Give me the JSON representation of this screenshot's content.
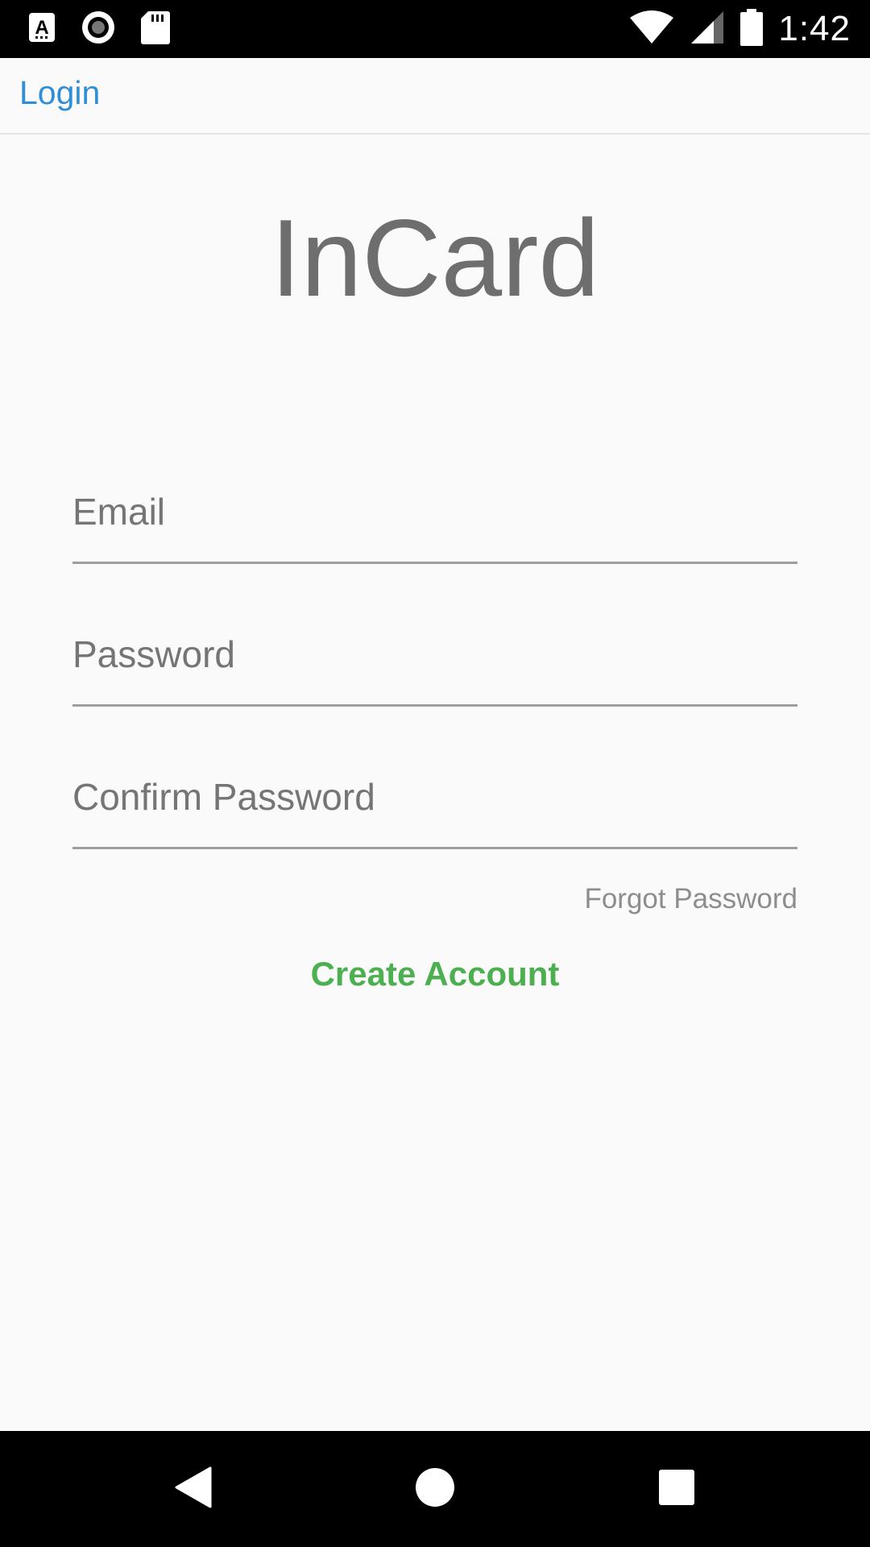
{
  "status_bar": {
    "time": "1:42",
    "icons": [
      "a-icon",
      "record-icon",
      "sd-card-icon",
      "wifi-icon",
      "signal-icon",
      "battery-icon"
    ]
  },
  "top_bar": {
    "back_label": "Login"
  },
  "app": {
    "title": "InCard"
  },
  "form": {
    "email_placeholder": "Email",
    "password_placeholder": "Password",
    "confirm_placeholder": "Confirm Password",
    "forgot_label": "Forgot Password",
    "create_label": "Create Account"
  },
  "colors": {
    "link_blue": "#2e8fd8",
    "accent_green": "#4caf50",
    "text_gray": "#6e6e6e",
    "background": "#fafafa"
  },
  "nav_bar": {
    "icons": [
      "back-icon",
      "home-icon",
      "recent-apps-icon"
    ]
  }
}
